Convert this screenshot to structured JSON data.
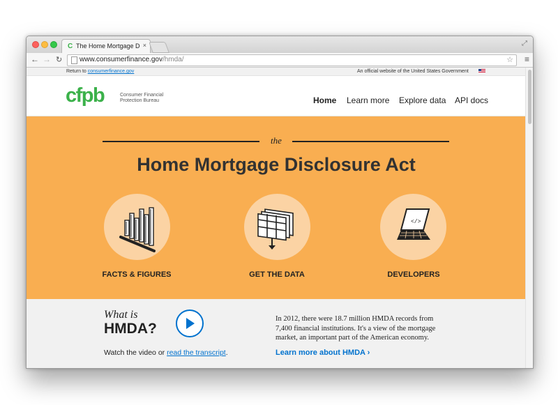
{
  "browser": {
    "tab_title": "The Home Mortgage Disclo",
    "tab_favicon": "C",
    "tab_close": "×",
    "url_domain": "www.consumerfinance.gov",
    "url_path": "/hmda/"
  },
  "icons": {
    "back": "←",
    "forward": "→",
    "reload": "↻",
    "star": "☆",
    "menu": "≡",
    "fullscreen": "⤢"
  },
  "topbar": {
    "return_prefix": "Return to ",
    "return_link": "consumerfinance.gov",
    "official": "An official website of the United States Government"
  },
  "header": {
    "logo": "cfpb",
    "logo_sub": "Consumer Financial Protection Bureau",
    "nav": [
      "Home",
      "Learn more",
      "Explore data",
      "API docs"
    ]
  },
  "hero": {
    "kicker": "the",
    "title": "Home Mortgage Disclosure Act",
    "features": [
      "FACTS & FIGURES",
      "GET THE DATA",
      "DEVELOPERS"
    ],
    "feature_icons": [
      "bar-chart-icon",
      "data-table-icon",
      "laptop-code-icon"
    ]
  },
  "lower": {
    "whatis": "What is",
    "hmda": "HMDA?",
    "watch_prefix": "Watch the video or ",
    "watch_link": "read the transcript",
    "watch_suffix": ".",
    "description": "In 2012, there were 18.7 million HMDA records from 7,400 financial institutions. It's a view of the mortgage market, an important part of the American economy.",
    "learn_more": "Learn more about HMDA ›"
  },
  "colors": {
    "hero_bg": "#f9ae51",
    "circle_bg": "#fbd3a4",
    "brand_green": "#3bb14a",
    "link_blue": "#0072ce"
  }
}
